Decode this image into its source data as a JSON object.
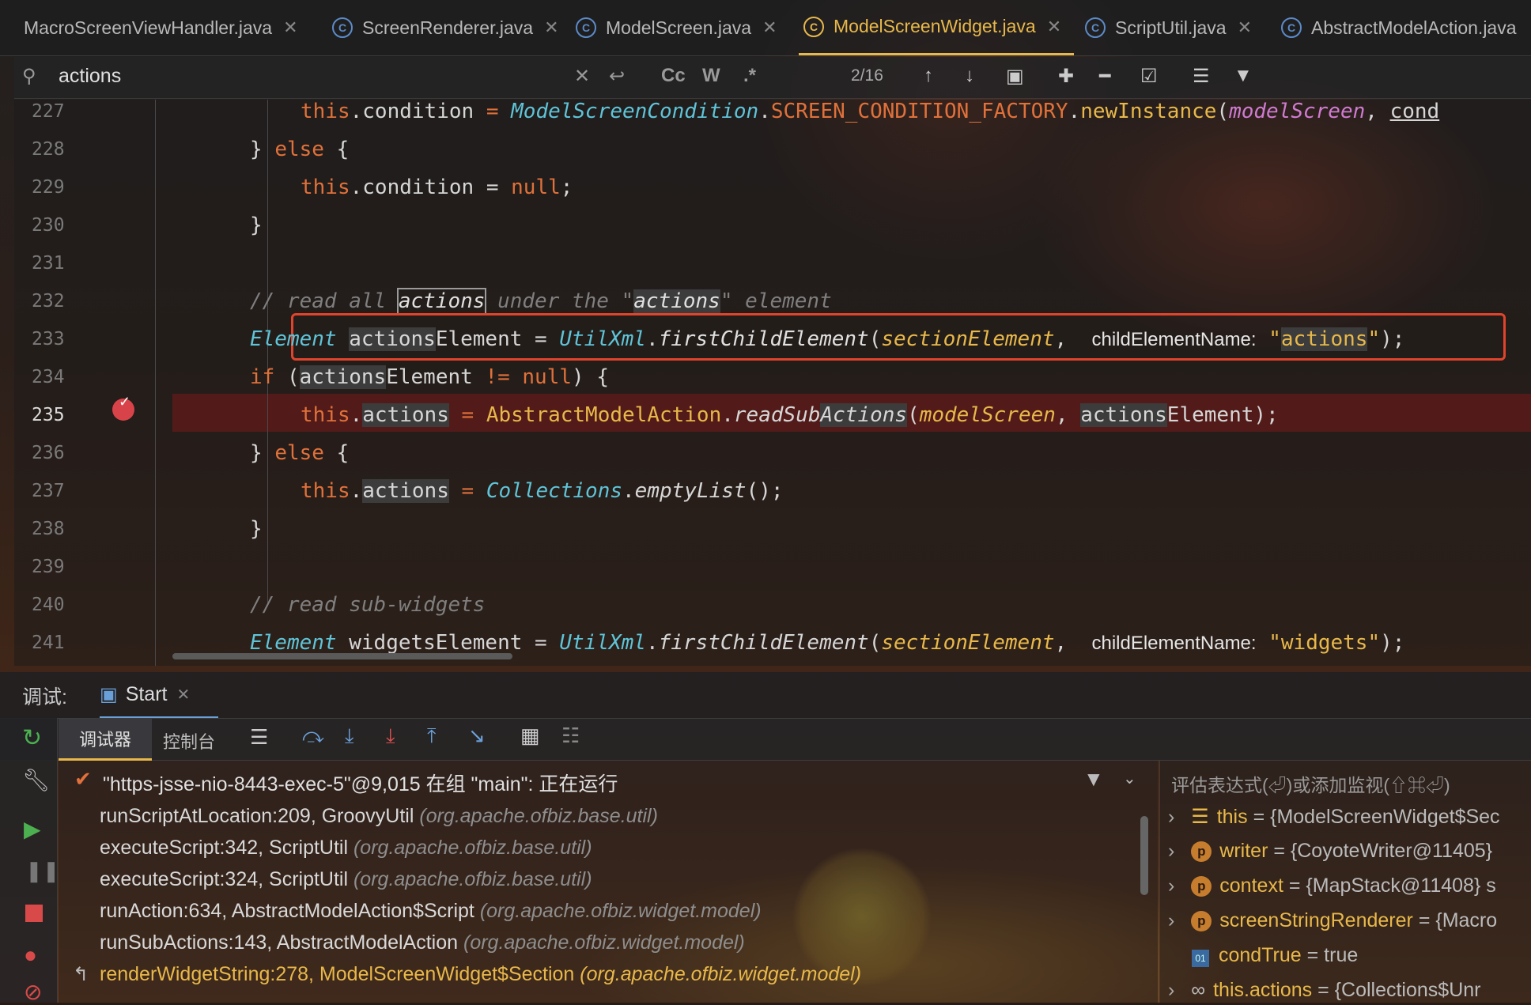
{
  "tabs": [
    {
      "label": "MacroScreenViewHandler.java"
    },
    {
      "label": "ScreenRenderer.java"
    },
    {
      "label": "ModelScreen.java"
    },
    {
      "label": "ModelScreenWidget.java",
      "active": true
    },
    {
      "label": "ScriptUtil.java"
    },
    {
      "label": "AbstractModelAction.java"
    }
  ],
  "search": {
    "query": "actions",
    "match_count": "2/16",
    "case_label": "Cc",
    "word_label": "W",
    "regex_label": ".*"
  },
  "editor": {
    "line_numbers": [
      "227",
      "228",
      "229",
      "230",
      "231",
      "232",
      "233",
      "234",
      "235",
      "236",
      "237",
      "238",
      "239",
      "240",
      "241"
    ],
    "breakpoint_line": "235",
    "lines": {
      "l227": {
        "this": "this",
        "dot": ".",
        "field": "condition",
        " eq": " = ",
        "cls": "ModelScreenCondition",
        "cst": "SCREEN_CONDITION_FACTORY",
        "mth": "newInstance",
        "prm": "modelScreen",
        "tail": "cond"
      },
      "l228": {
        "a": "} ",
        "kw": "else",
        "b": " {"
      },
      "l229": {
        "this": "this",
        "field": ".condition",
        "eq": " = ",
        "kw": "null",
        "end": ";"
      },
      "l230": {
        "a": "}"
      },
      "l232": {
        "c1": "// read all ",
        "hl": "actions",
        "c2": " under the \"",
        "hl2": "actions",
        "c3": "\" element"
      },
      "l233": {
        "cls": "Element",
        "sp": " ",
        "hl": "actions",
        "var": "Element",
        "eq": " = ",
        "cls2": "UtilXml",
        "dot": ".",
        "mth": "firstChildElement",
        "paren": "(",
        "prm": "sectionElement",
        "comma": ",",
        "hint": "childElementName:",
        "q1": "\"",
        "str": "actions",
        "q2": "\"",
        "end": ");"
      },
      "l234": {
        "kw": "if",
        "a": " (",
        "hl": "actions",
        "var": "Element",
        "op": " != ",
        "kw2": "null",
        "b": ") {"
      },
      "l235": {
        "this": "this",
        "dot": ".",
        "hl": "actions",
        "eq": " = ",
        "cls": "AbstractModelAction",
        "dot2": ".",
        "mth": "readSub",
        "hl2": "Actions",
        "paren": "(",
        "prm": "modelScreen",
        "comma": ", ",
        "hl3": "actions",
        "var": "Element",
        "end": ");"
      },
      "l236": {
        "a": "} ",
        "kw": "else",
        "b": " {"
      },
      "l237": {
        "this": "this",
        "dot": ".",
        "hl": "actions",
        "eq": " = ",
        "cls": "Collections",
        "dot2": ".",
        "mth": "emptyList",
        "end": "();"
      },
      "l238": {
        "a": "}"
      },
      "l240": {
        "cmt": "// read sub-widgets"
      },
      "l241": {
        "cls": "Element",
        "sp": " widgetsElement",
        "eq": " = ",
        "cls2": "UtilXml",
        "dot": ".",
        "mth": "firstChildElement",
        "paren": "(",
        "prm": "sectionElement",
        "comma": ",",
        "hint": "childElementName:",
        "str": "\"widgets\"",
        "end": ");"
      }
    }
  },
  "debug": {
    "label": "调试:",
    "session_tab": "Start",
    "tabs": [
      "调试器",
      "控制台"
    ],
    "thread": "\"https-jsse-nio-8443-exec-5\"@9,015 在组 \"main\": 正在运行",
    "frames": [
      {
        "method": "runScriptAtLocation:209, GroovyUtil",
        "pkg": "(org.apache.ofbiz.base.util)"
      },
      {
        "method": "executeScript:342, ScriptUtil",
        "pkg": "(org.apache.ofbiz.base.util)"
      },
      {
        "method": "executeScript:324, ScriptUtil",
        "pkg": "(org.apache.ofbiz.base.util)"
      },
      {
        "method": "runAction:634, AbstractModelAction$Script",
        "pkg": "(org.apache.ofbiz.widget.model)"
      },
      {
        "method": "runSubActions:143, AbstractModelAction",
        "pkg": "(org.apache.ofbiz.widget.model)"
      },
      {
        "method": "renderWidgetString:278, ModelScreenWidget$Section",
        "pkg": "(org.apache.ofbiz.widget.model)"
      }
    ],
    "watch_placeholder": "评估表达式(⏎)或添加监视(⇧⌘⏎)",
    "variables": [
      {
        "name": "this",
        "value": "= {ModelScreenWidget$Sec"
      },
      {
        "name": "writer",
        "value": "= {CoyoteWriter@11405}"
      },
      {
        "name": "context",
        "value": "= {MapStack@11408}  s"
      },
      {
        "name": "screenStringRenderer",
        "value": "= {Macro"
      },
      {
        "name": "condTrue",
        "value": "= true"
      },
      {
        "name": "this.actions",
        "value": "= {Collections$Unr"
      }
    ]
  }
}
